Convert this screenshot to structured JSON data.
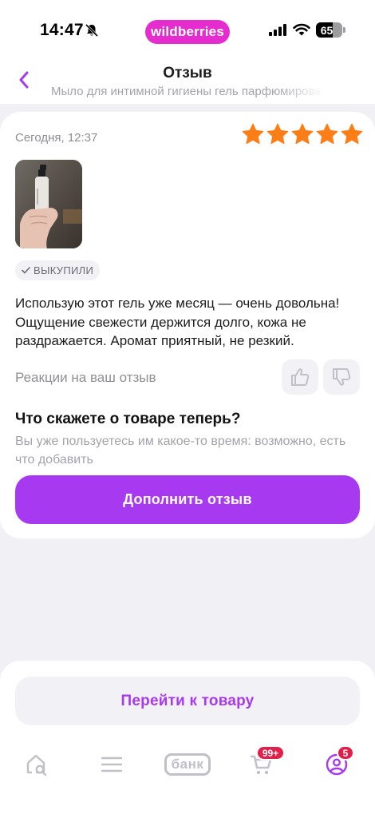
{
  "status_bar": {
    "time": "14:47",
    "app_pill": "wildberries",
    "battery": "65",
    "battery_level_percent": 65
  },
  "header": {
    "title": "Отзыв",
    "subtitle": "Мыло для интимной гигиены гель парфюмирова"
  },
  "review": {
    "date": "Сегодня, 12:37",
    "rating": 5,
    "rating_color": "#fd7e17",
    "badge": "ВЫКУПИЛИ",
    "text": "Использую этот гель уже месяц — очень довольна! Ощущение свежести держится долго, кожа не раздражается. Аромат приятный, не резкий.",
    "reactions_label": "Реакции на ваш отзыв",
    "prompt_title": "Что скажете о товаре теперь?",
    "prompt_text": "Вы уже пользуетесь им какое-то время: возможно, есть что добавить",
    "supplement_button": "Дополнить отзыв"
  },
  "bottom": {
    "goto_button": "Перейти к товару"
  },
  "tab_bar": {
    "bank_label": "банк",
    "cart_badge": "99+",
    "profile_badge": "5",
    "icons": [
      "home-search-icon",
      "menu-icon",
      "bank-logo",
      "cart-icon",
      "profile-icon"
    ]
  },
  "colors": {
    "accent": "#a73af1",
    "brand_pink": "#e52ccf",
    "badge_red": "#e21e4a"
  }
}
